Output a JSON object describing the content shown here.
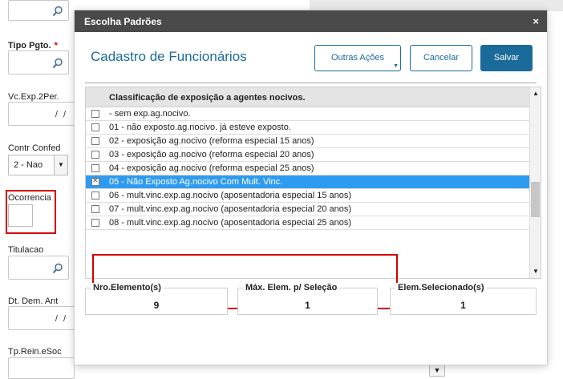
{
  "background": {
    "fields": [
      {
        "label": "Tipo Pgto.",
        "required": true
      },
      {
        "label": "Vc.Exp.2Per.",
        "value": "/ /"
      },
      {
        "label": "Contr Confed",
        "select_value": "2 - Nao"
      },
      {
        "label": "Ocorrencia"
      },
      {
        "label": "Titulacao"
      },
      {
        "label": "Dt. Dem. Ant",
        "value": "/ /"
      },
      {
        "label": "Tp.Rein.eSoc"
      }
    ],
    "required_mark": "*"
  },
  "modal": {
    "title": "Escolha Padrões",
    "close": "×",
    "page_title": "Cadastro de Funcionários",
    "buttons": {
      "more_actions": "Outras Ações",
      "cancel": "Cancelar",
      "save": "Salvar"
    },
    "list": {
      "header": "Classificação de exposição a agentes nocivos.",
      "rows": [
        {
          "text": " - sem exp.ag.nocivo.",
          "checked": false,
          "selected": false
        },
        {
          "text": "01 - não exposto.ag.nocivo. já esteve exposto.",
          "checked": false,
          "selected": false
        },
        {
          "text": "02 - exposição ag.nocivo (reforma especial 15 anos)",
          "checked": false,
          "selected": false
        },
        {
          "text": "03 - exposição ag.nocivo (reforma especial 20 anos)",
          "checked": false,
          "selected": false
        },
        {
          "text": "04 - exposição ag.nocivo (reforma especial 25 anos)",
          "checked": false,
          "selected": false
        },
        {
          "text": "05 - Não Exposto Ag.nocivo Com Mult. Vinc.",
          "checked": true,
          "selected": true
        },
        {
          "text": "06 - mult.vinc.exp.ag.nocivo (aposentadoria especial 15 anos)",
          "checked": false,
          "selected": false
        },
        {
          "text": "07 - mult.vinc.exp.ag.nocivo (aposentadoria especial 20 anos)",
          "checked": false,
          "selected": false
        },
        {
          "text": "08 - mult.vinc.exp.ag.nocivo (aposentadoria especial 25 anos)",
          "checked": false,
          "selected": false
        }
      ]
    },
    "stats": {
      "nro_label": "Nro.Elemento(s)",
      "nro_value": "9",
      "max_label": "Máx. Elem. p/ Seleção",
      "max_value": "1",
      "sel_label": "Elem.Selecionado(s)",
      "sel_value": "1"
    }
  },
  "colors": {
    "header_bg": "#4a4a4a",
    "accent": "#1a6b9a",
    "selected_row": "#2f9bf0",
    "highlight_border": "#d40000"
  }
}
